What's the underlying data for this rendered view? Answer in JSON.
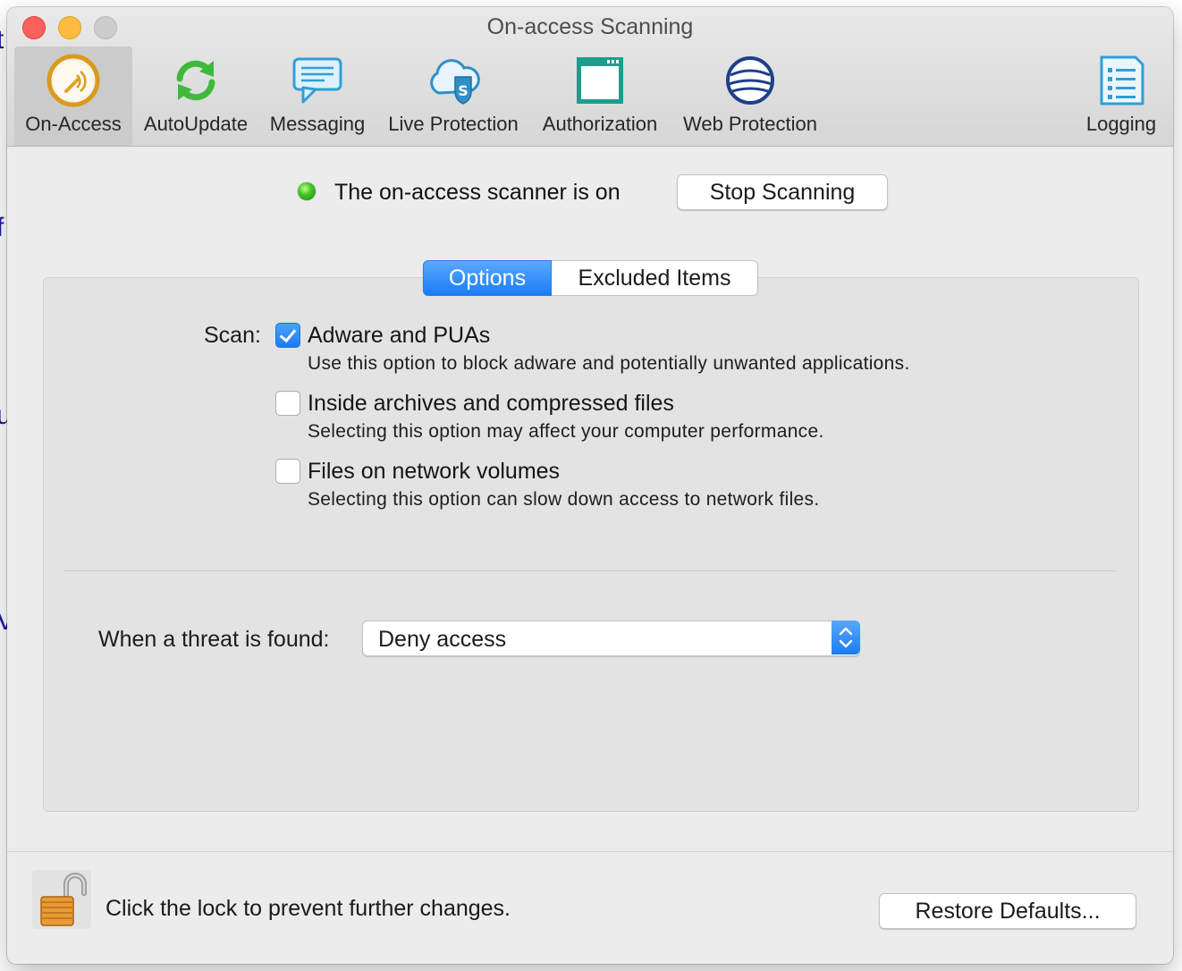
{
  "window": {
    "title": "On-access Scanning"
  },
  "toolbar": {
    "items": [
      {
        "label": "On-Access",
        "icon": "on-access-icon",
        "selected": true
      },
      {
        "label": "AutoUpdate",
        "icon": "autoupdate-icon",
        "selected": false
      },
      {
        "label": "Messaging",
        "icon": "messaging-icon",
        "selected": false
      },
      {
        "label": "Live Protection",
        "icon": "live-protection-icon",
        "selected": false
      },
      {
        "label": "Authorization",
        "icon": "authorization-icon",
        "selected": false
      },
      {
        "label": "Web Protection",
        "icon": "web-protection-icon",
        "selected": false
      },
      {
        "label": "Logging",
        "icon": "logging-icon",
        "selected": false
      }
    ]
  },
  "status": {
    "text": "The on-access scanner is on",
    "indicator_color": "#45c524",
    "stop_button": "Stop Scanning"
  },
  "tabs": [
    {
      "label": "Options",
      "active": true
    },
    {
      "label": "Excluded Items",
      "active": false
    }
  ],
  "options": {
    "scan_label": "Scan:",
    "items": [
      {
        "title": "Adware and PUAs",
        "description": "Use this option to block adware and potentially unwanted applications.",
        "checked": true
      },
      {
        "title": "Inside archives and compressed files",
        "description": "Selecting this option may affect your computer performance.",
        "checked": false
      },
      {
        "title": "Files on network volumes",
        "description": "Selecting this option can slow down access to network files.",
        "checked": false
      }
    ]
  },
  "threat": {
    "label": "When a threat is found:",
    "selected": "Deny access"
  },
  "footer": {
    "lock_text": "Click the lock to prevent further changes.",
    "restore_button": "Restore Defaults..."
  },
  "colors": {
    "accent": "#1a7cf5",
    "window_bg": "#ececec",
    "panel_bg": "#e3e3e3"
  }
}
